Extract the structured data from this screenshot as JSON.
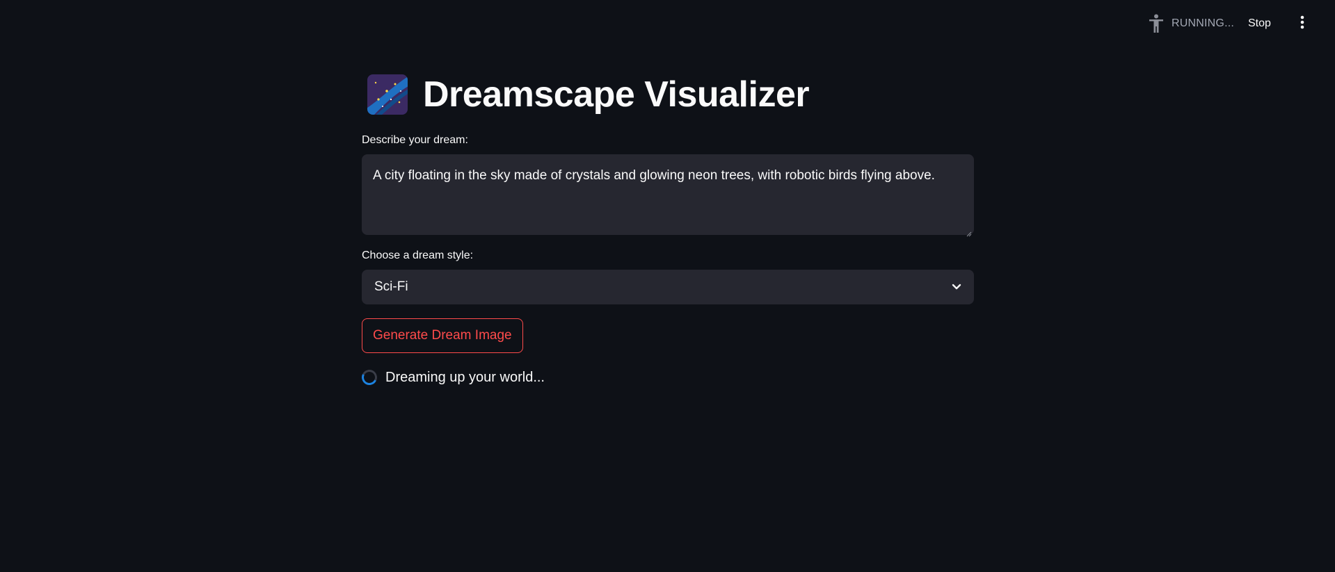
{
  "header": {
    "status_label": "RUNNING...",
    "stop_label": "Stop",
    "status_icon": "running-man-icon",
    "menu_icon": "vertical-ellipsis-icon"
  },
  "main": {
    "title": "Dreamscape Visualizer",
    "title_icon": "milky-way-icon",
    "dream_input": {
      "label": "Describe your dream:",
      "value": "A city floating in the sky made of crystals and glowing neon trees, with robotic birds flying above."
    },
    "style_select": {
      "label": "Choose a dream style:",
      "value": "Sci-Fi"
    },
    "generate_label": "Generate Dream Image",
    "spinner_text": "Dreaming up your world..."
  },
  "colors": {
    "background": "#0e1117",
    "input_background": "#262730",
    "primary": "#ff4b4b",
    "spinner_accent": "#1c83e1"
  }
}
